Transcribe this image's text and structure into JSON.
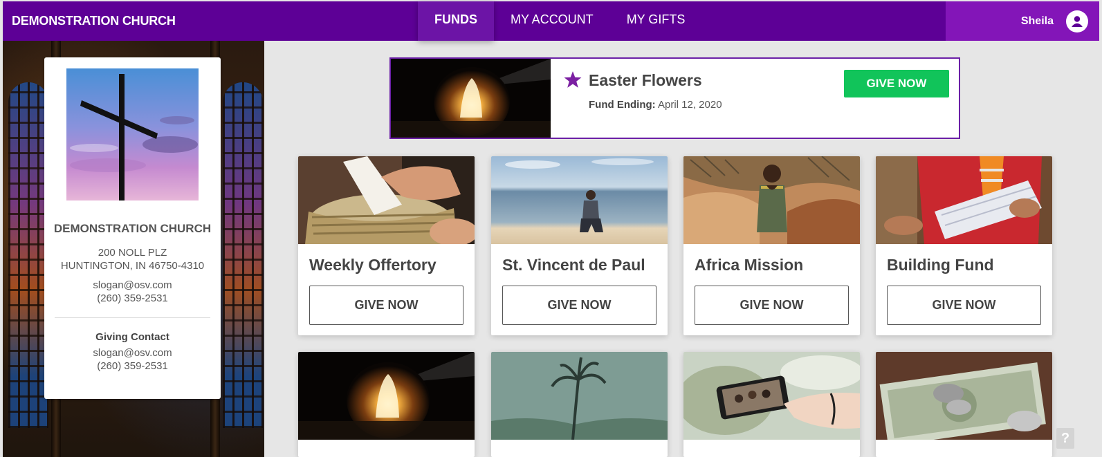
{
  "brand": "DEMONSTRATION CHURCH",
  "nav": {
    "items": [
      {
        "label": "FUNDS",
        "active": true
      },
      {
        "label": "MY ACCOUNT",
        "active": false
      },
      {
        "label": "MY GIFTS",
        "active": false
      }
    ]
  },
  "user": {
    "name": "Sheila",
    "icon": "account-circle-icon"
  },
  "church": {
    "name": "DEMONSTRATION CHURCH",
    "address_line1": "200 NOLL PLZ",
    "address_line2": "HUNTINGTON, IN 46750-4310",
    "email": "slogan@osv.com",
    "phone": "(260) 359-2531",
    "giving_contact_title": "Giving Contact",
    "giving_email": "slogan@osv.com",
    "giving_phone": "(260) 359-2531"
  },
  "featured": {
    "title": "Easter Flowers",
    "ending_label": "Fund Ending:",
    "ending_date": "April 12, 2020",
    "button": "GIVE NOW",
    "icon": "star-icon"
  },
  "funds": [
    {
      "title": "Weekly Offertory",
      "button": "GIVE NOW"
    },
    {
      "title": "St. Vincent de Paul",
      "button": "GIVE NOW"
    },
    {
      "title": "Africa Mission",
      "button": "GIVE NOW"
    },
    {
      "title": "Building Fund",
      "button": "GIVE NOW"
    }
  ],
  "colors": {
    "nav_bg": "#5d0096",
    "accent_purple": "#6b1fa6",
    "give_green": "#11c45a"
  },
  "help_icon": "?"
}
